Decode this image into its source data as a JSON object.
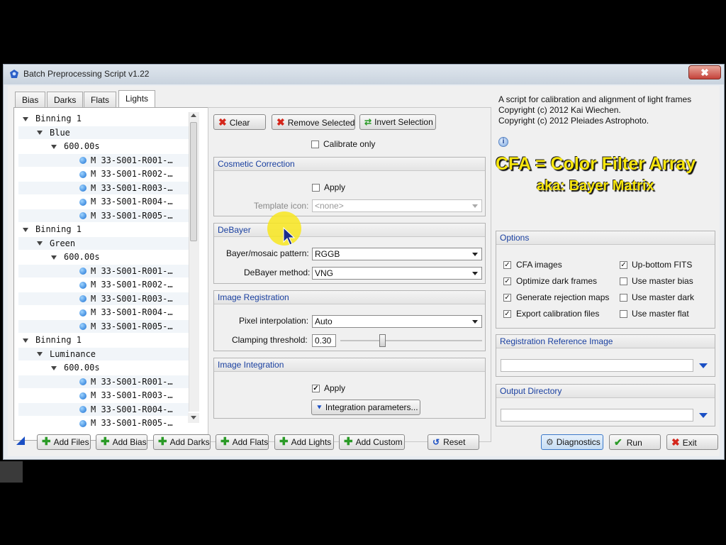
{
  "window": {
    "title": "Batch Preprocessing Script v1.22",
    "close_glyph": "✖"
  },
  "tabs": [
    "Bias",
    "Darks",
    "Flats",
    "Lights"
  ],
  "active_tab": "Lights",
  "tree": [
    {
      "level": 0,
      "text": "Binning 1",
      "type": "group"
    },
    {
      "level": 1,
      "text": "Blue",
      "type": "group"
    },
    {
      "level": 2,
      "text": "600.00s",
      "type": "group"
    },
    {
      "level": 3,
      "text": "M 33-S001-R001-…",
      "type": "file"
    },
    {
      "level": 3,
      "text": "M 33-S001-R002-…",
      "type": "file"
    },
    {
      "level": 3,
      "text": "M 33-S001-R003-…",
      "type": "file"
    },
    {
      "level": 3,
      "text": "M 33-S001-R004-…",
      "type": "file"
    },
    {
      "level": 3,
      "text": "M 33-S001-R005-…",
      "type": "file"
    },
    {
      "level": 0,
      "text": "Binning 1",
      "type": "group"
    },
    {
      "level": 1,
      "text": "Green",
      "type": "group"
    },
    {
      "level": 2,
      "text": "600.00s",
      "type": "group"
    },
    {
      "level": 3,
      "text": "M 33-S001-R001-…",
      "type": "file"
    },
    {
      "level": 3,
      "text": "M 33-S001-R002-…",
      "type": "file"
    },
    {
      "level": 3,
      "text": "M 33-S001-R003-…",
      "type": "file"
    },
    {
      "level": 3,
      "text": "M 33-S001-R004-…",
      "type": "file"
    },
    {
      "level": 3,
      "text": "M 33-S001-R005-…",
      "type": "file"
    },
    {
      "level": 0,
      "text": "Binning 1",
      "type": "group"
    },
    {
      "level": 1,
      "text": "Luminance",
      "type": "group"
    },
    {
      "level": 2,
      "text": "600.00s",
      "type": "group"
    },
    {
      "level": 3,
      "text": "M 33-S001-R001-…",
      "type": "file"
    },
    {
      "level": 3,
      "text": "M 33-S001-R003-…",
      "type": "file"
    },
    {
      "level": 3,
      "text": "M 33-S001-R004-…",
      "type": "file"
    },
    {
      "level": 3,
      "text": "M 33-S001-R005-…",
      "type": "file"
    }
  ],
  "middle": {
    "clear": "Clear",
    "remove_selected": "Remove Selected",
    "invert_selection": "Invert Selection",
    "calibrate_only": "Calibrate only",
    "cosmetic": {
      "title": "Cosmetic Correction",
      "apply": "Apply",
      "template_label": "Template icon:",
      "template_value": "<none>"
    },
    "debayer": {
      "title": "DeBayer",
      "pattern_label": "Bayer/mosaic pattern:",
      "pattern_value": "RGGB",
      "method_label": "DeBayer method:",
      "method_value": "VNG"
    },
    "registration": {
      "title": "Image Registration",
      "interp_label": "Pixel interpolation:",
      "interp_value": "Auto",
      "clamp_label": "Clamping threshold:",
      "clamp_value": "0.30"
    },
    "integration": {
      "title": "Image Integration",
      "apply": "Apply",
      "params_button": "Integration parameters..."
    }
  },
  "right": {
    "description": [
      "A script for calibration and alignment of light frames",
      "Copyright (c) 2012 Kai Wiechen.",
      "Copyright (c) 2012 Pleiades Astrophoto."
    ],
    "overlay_line1": "CFA = Color Filter Array",
    "overlay_line2": "aka: Bayer Matrix",
    "options_title": "Options",
    "options": {
      "cfa_images": "CFA images",
      "up_bottom_fits": "Up-bottom FITS",
      "optimize_dark": "Optimize dark frames",
      "use_master_bias": "Use master bias",
      "gen_rejection": "Generate rejection maps",
      "use_master_dark": "Use master dark",
      "export_calib": "Export calibration files",
      "use_master_flat": "Use master flat"
    },
    "reg_ref_title": "Registration Reference Image",
    "output_dir_title": "Output Directory"
  },
  "bottom": {
    "add_files": "Add Files",
    "add_bias": "Add Bias",
    "add_darks": "Add Darks",
    "add_flats": "Add Flats",
    "add_lights": "Add Lights",
    "add_custom": "Add Custom",
    "reset": "Reset",
    "diagnostics": "Diagnostics",
    "run": "Run",
    "exit": "Exit"
  },
  "colors": {
    "accent_blue": "#1a40a0",
    "overlay_yellow": "#f7e60c",
    "red": "#d4261b",
    "green": "#2a9a26"
  },
  "icons": [
    "close-icon",
    "script-icon",
    "red-x-icon",
    "invert-icon",
    "checkbox-icon",
    "chevron-down-icon",
    "info-icon",
    "plus-icon",
    "reset-icon",
    "gear-icon",
    "check-icon",
    "dropdown-arrow-icon",
    "mouse-cursor-icon"
  ]
}
